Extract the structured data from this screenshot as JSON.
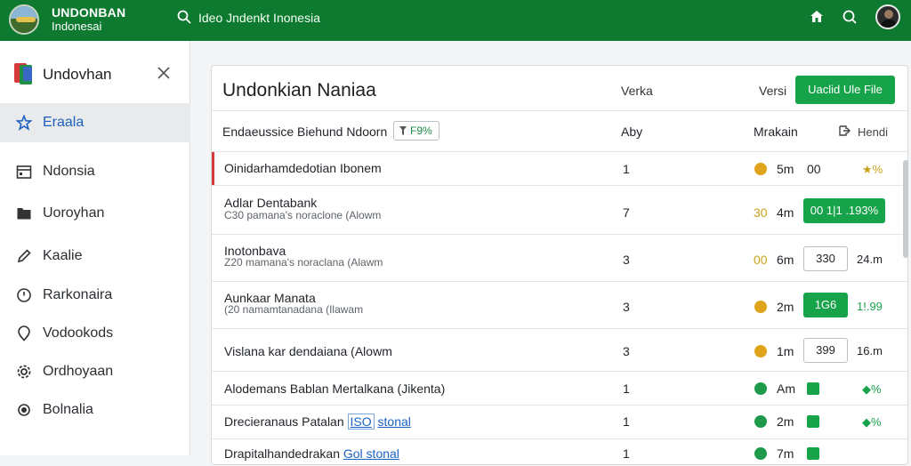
{
  "topbar": {
    "brand_title": "UNDONBAN",
    "brand_sub": "Indonesai",
    "search_text": "Ideo Jndenkt Inonesia",
    "icons": [
      "search-icon",
      "home-icon",
      "search-icon",
      "avatar"
    ]
  },
  "sidebar": {
    "title": "Undovhan",
    "items": [
      {
        "label": "Eraala",
        "icon": "star-icon",
        "active": true
      },
      {
        "label": "Ndonsia",
        "icon": "calendar-icon"
      },
      {
        "label": "Uoroyhan",
        "icon": "folder-icon"
      },
      {
        "label": "Kaalie",
        "icon": "pen-icon"
      },
      {
        "label": "Rarkonaira",
        "icon": "clock-icon"
      },
      {
        "label": "Vodookods",
        "icon": "pin-icon"
      },
      {
        "label": "Ordhoyaan",
        "icon": "gear-icon"
      },
      {
        "label": "Bolnalia",
        "icon": "circle-icon"
      }
    ]
  },
  "main": {
    "title": "Undonkian Naniaa",
    "verka": "Verka",
    "versi": "Versi",
    "upload_label": "Uaclid Ule File",
    "columns": {
      "name": "Endaeussice Biehund Ndoorn",
      "filter": "F9%",
      "aby": "Aby",
      "makain": "Mrakain",
      "hendi": "Hendi"
    },
    "rows": [
      {
        "name": "Oinidarhamdedotian Ibonem",
        "num": "1",
        "time": "5m",
        "extra": "00",
        "right": "★%",
        "dot": "#e0a41c"
      },
      {
        "name": "Adlar Dentabank",
        "sub": "C30 pamana's noraclone (Alowm",
        "num": "7",
        "time": "4m",
        "dot_label": "30",
        "badge": "00 1|1 .193%"
      },
      {
        "name": "Inotonbava",
        "sub": "Z20 mamana's noraclana (Alawm",
        "num": "3",
        "time": "6m",
        "dot_label": "00",
        "boxed": "330",
        "right": "24.m"
      },
      {
        "name": "Aunkaar Manata",
        "sub": "(20 namamtanadana (Ilawam",
        "num": "3",
        "time": "2m",
        "dot": "#e0a41c",
        "badge": "1G6",
        "right": "1!.99"
      },
      {
        "name": "Vislana kar dendaiana (Alowm",
        "num": "3",
        "time": "1m",
        "dot": "#e0a41c",
        "boxed": "399",
        "right": "16.m"
      },
      {
        "name": "Alodemans Bablan Mertalkana (Jikenta)",
        "num": "1",
        "time": "Am",
        "dot": "#1e9a4a",
        "check": true,
        "right": "◆%"
      },
      {
        "name": "Drecieranaus Patalan",
        "link": "ISO",
        "link2": "stonal",
        "num": "1",
        "time": "2m",
        "dot": "#1e9a4a",
        "check": true,
        "right": "◆%"
      },
      {
        "name": "Drapitalhandedrakan",
        "link2": "Gol stonal",
        "num": "1",
        "time": "7m",
        "dot": "#1e9a4a",
        "check": true
      }
    ]
  },
  "colors": {
    "brand_green": "#0e7a2f",
    "button_green": "#17a34a",
    "active_blue": "#1d5fbf",
    "accent_red": "#d73a3a"
  }
}
